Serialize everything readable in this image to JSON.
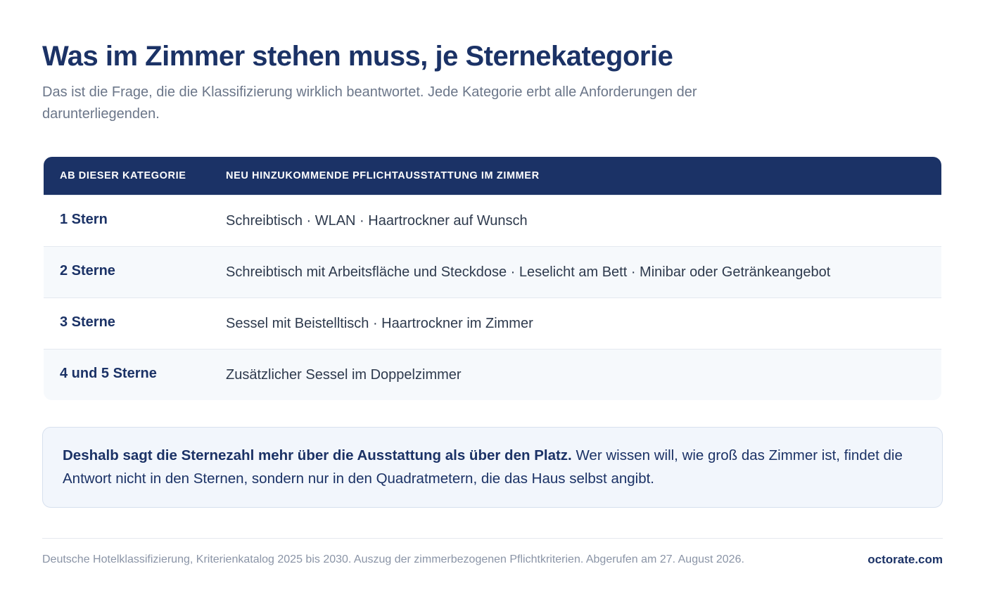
{
  "header": {
    "title": "Was im Zimmer stehen muss, je Sternekategorie",
    "subtitle": "Das ist die Frage, die die Klassifizierung wirklich beantwortet. Jede Kategorie erbt alle Anforderungen der darunterliegenden."
  },
  "table": {
    "columns": [
      "AB DIESER KATEGORIE",
      "NEU HINZUKOMMENDE PFLICHTAUSSTATTUNG IM ZIMMER"
    ],
    "rows": [
      {
        "category": "1 Stern",
        "equipment": "Schreibtisch · WLAN · Haartrockner auf Wunsch"
      },
      {
        "category": "2 Sterne",
        "equipment": "Schreibtisch mit Arbeitsfläche und Steckdose · Leselicht am Bett · Minibar oder Getränkeangebot"
      },
      {
        "category": "3 Sterne",
        "equipment": "Sessel mit Beistelltisch · Haartrockner im Zimmer"
      },
      {
        "category": "4 und 5 Sterne",
        "equipment": "Zusätzlicher Sessel im Doppelzimmer"
      }
    ]
  },
  "callout": {
    "bold": "Deshalb sagt die Sternezahl mehr über die Ausstattung als über den Platz.",
    "text": " Wer wissen will, wie groß das Zimmer ist, findet die Antwort nicht in den Sternen, sondern nur in den Quadratmetern, die das Haus selbst angibt."
  },
  "footer": {
    "source": "Deutsche Hotelklassifizierung, Kriterienkatalog 2025 bis 2030. Auszug der zimmerbezogenen Pflichtkriterien. Abgerufen am 27. August 2026.",
    "brand": "octorate.com"
  }
}
